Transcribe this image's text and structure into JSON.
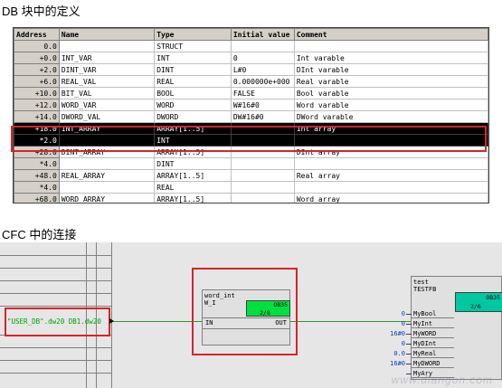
{
  "headings": {
    "db_definition": "DB 块中的定义",
    "cfc_connection": "CFC 中的连接"
  },
  "db_table": {
    "columns": [
      "Address",
      "Name",
      "Type",
      "Initial value",
      "Comment"
    ],
    "rows": [
      {
        "address": "0.0",
        "name": "",
        "type": "STRUCT",
        "initial": "",
        "comment": ""
      },
      {
        "address": "+0.0",
        "name": "INT_VAR",
        "type": "INT",
        "initial": "0",
        "comment": "Int varable"
      },
      {
        "address": "+2.0",
        "name": "DINT_VAR",
        "type": "DINT",
        "initial": "L#0",
        "comment": "DInt varable"
      },
      {
        "address": "+6.0",
        "name": "REAL_VAL",
        "type": "REAL",
        "initial": "0.000000e+000",
        "comment": "Real varable"
      },
      {
        "address": "+10.0",
        "name": "BIT_VAL",
        "type": "BOOL",
        "initial": "FALSE",
        "comment": "Bool varable"
      },
      {
        "address": "+12.0",
        "name": "WORD_VAR",
        "type": "WORD",
        "initial": "W#16#0",
        "comment": "Word varable"
      },
      {
        "address": "+14.0",
        "name": "DWORD_VAL",
        "type": "DWORD",
        "initial": "DW#16#0",
        "comment": "DWord varable"
      },
      {
        "address": "+18.0",
        "name": "INT_ARRAY",
        "type": "ARRAY[1..5]",
        "initial": "",
        "comment": "Int array",
        "selected": true
      },
      {
        "address": "*2.0",
        "name": "",
        "type": "INT",
        "initial": "",
        "comment": "",
        "selected": true
      },
      {
        "address": "+28.0",
        "name": "DINT_ARRAY",
        "type": "ARRAY[1..5]",
        "initial": "",
        "comment": "DInt array"
      },
      {
        "address": "*4.0",
        "name": "",
        "type": "DINT",
        "initial": "",
        "comment": ""
      },
      {
        "address": "+48.0",
        "name": "REAL_ARRAY",
        "type": "ARRAY[1..5]",
        "initial": "",
        "comment": "Real array"
      },
      {
        "address": "*4.0",
        "name": "",
        "type": "REAL",
        "initial": "",
        "comment": ""
      },
      {
        "address": "+68.0",
        "name": "WORD_ARRAY",
        "type": "ARRAY[1..5]",
        "initial": "",
        "comment": "Word array"
      }
    ]
  },
  "cfc": {
    "connection_label": "\"USER_DB\".dw20 DB1.dw20",
    "word_int_block": {
      "title_line1": "word_int",
      "title_line2": "W_I",
      "green_top": "OB35",
      "green_bottom": "2/8",
      "input_pin": "IN",
      "output_pin": "OUT"
    },
    "test_block": {
      "title_line1": "test",
      "title_line2": "TESTFB",
      "green_top": "OB35",
      "green_bottom": "2/6",
      "pins": [
        {
          "value": "0",
          "name": "MyBool"
        },
        {
          "value": "0",
          "name": "MyInt"
        },
        {
          "value": "16#0",
          "name": "MyWORD"
        },
        {
          "value": "0",
          "name": "MyDInt"
        },
        {
          "value": "0.0",
          "name": "MyReal"
        },
        {
          "value": "16#0",
          "name": "MyDWORD"
        },
        {
          "value": "",
          "name": "MyAry"
        }
      ]
    },
    "watermark": "www.diangon.com"
  },
  "colors": {
    "highlight_red": "#d8242a",
    "selection_black": "#000000",
    "status_green": "#00e040",
    "wire_green": "#2a9a2a",
    "pin_blue": "#1040c0"
  }
}
